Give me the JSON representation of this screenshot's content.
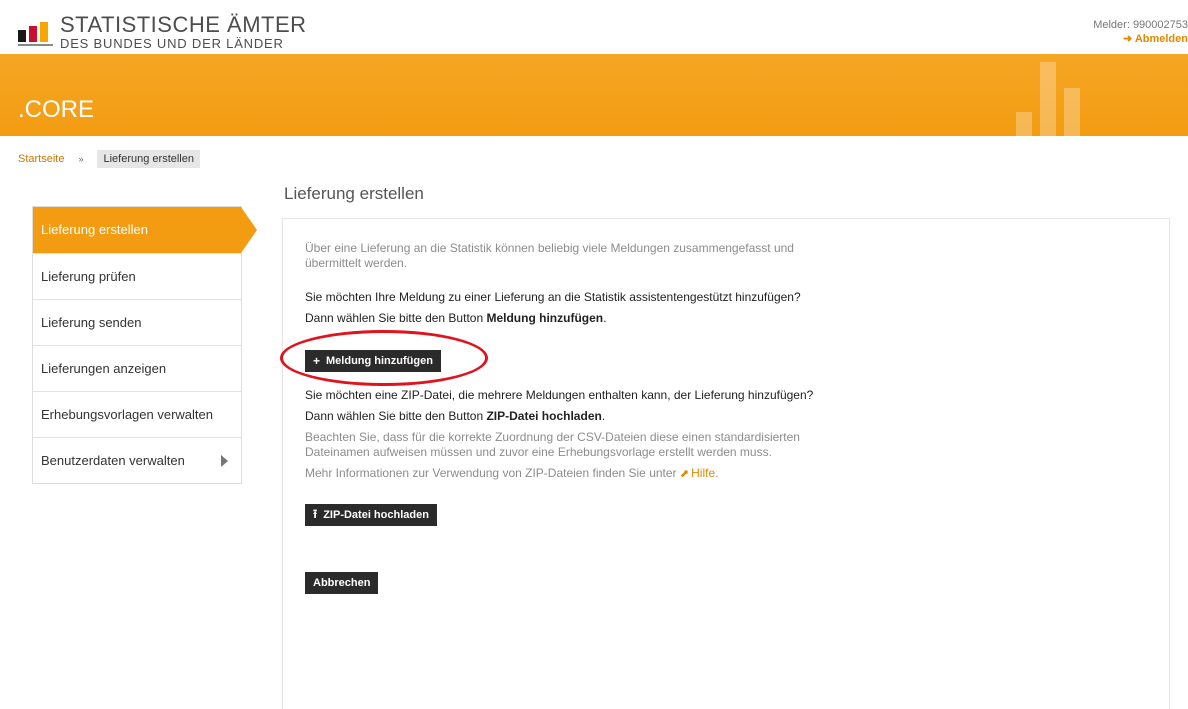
{
  "header": {
    "logo_line1": "STATISTISCHE ÄMTER",
    "logo_line2": "DES BUNDES UND DER LÄNDER",
    "melder": "Melder: 990002753",
    "logout_label": "Abmelden",
    "brand_color": "#f39c12"
  },
  "banner": {
    "title": ".CORE"
  },
  "breadcrumb": {
    "home": "Startseite",
    "separator": "»",
    "current": "Lieferung erstellen"
  },
  "page": {
    "title": "Lieferung erstellen"
  },
  "sidebar": {
    "items": [
      {
        "label": "Lieferung erstellen"
      },
      {
        "label": "Lieferung prüfen"
      },
      {
        "label": "Lieferung senden"
      },
      {
        "label": "Lieferungen anzeigen"
      },
      {
        "label": "Erhebungsvorlagen verwalten"
      },
      {
        "label": "Benutzerdaten verwalten"
      }
    ]
  },
  "content": {
    "intro": "Über eine Lieferung an die Statistik können beliebig viele Meldungen zusammengefasst und übermittelt werden.",
    "q1": "Sie möchten Ihre Meldung zu einer Lieferung an die Statistik assistentengestützt hinzufügen?",
    "hint1_prefix": "Dann wählen Sie bitte den Button ",
    "hint1_bold": "Meldung hinzufügen",
    "hint1_suffix": ".",
    "add_button": "Meldung hinzufügen",
    "q2": "Sie möchten eine ZIP-Datei, die mehrere Meldungen enthalten kann, der Lieferung hinzufügen?",
    "hint2_prefix": "Dann wählen Sie bitte den Button ",
    "hint2_bold": "ZIP-Datei hochladen",
    "hint2_suffix": ".",
    "note": "Beachten Sie, dass für die korrekte Zuordnung der CSV-Dateien diese einen standardisierten Dateinamen aufweisen müssen und zuvor eine Erhebungsvorlage erstellt werden muss.",
    "more_info_prefix": "Mehr Informationen zur Verwendung von ZIP-Dateien finden Sie unter ",
    "help_link": "Hilfe",
    "more_info_suffix": ".",
    "upload_button": "ZIP-Datei hochladen",
    "cancel_button": "Abbrechen"
  }
}
